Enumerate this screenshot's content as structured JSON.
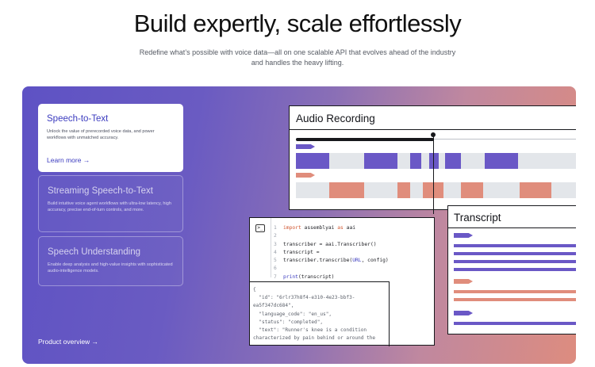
{
  "hero": {
    "title": "Build expertly, scale effortlessly",
    "subtitle": "Redefine what’s possible with voice data—all on one scalable API that evolves ahead of the industry and handles the heavy lifting."
  },
  "cards": [
    {
      "title": "Speech-to-Text",
      "desc": "Unlock the value of prerecorded voice data, and power workflows with unmatched accuracy.",
      "link": "Learn more →"
    },
    {
      "title": "Streaming Speech-to-Text",
      "desc": "Build intuitive voice agent workflows with ultra-low latency, high accuracy, precise end-of-turn controls, and more."
    },
    {
      "title": "Speech Understanding",
      "desc": "Enable deep analysis and high-value insights with sophisticated audio-intelligence models."
    }
  ],
  "product_overview": "Product overview →",
  "audio": {
    "title": "Audio Recording"
  },
  "transcript": {
    "title": "Transcript"
  },
  "code": {
    "terminal_icon": ">_",
    "line_numbers": [
      "1",
      "2",
      "3",
      "4",
      "5",
      "6",
      "7"
    ],
    "import_kw": "import",
    "import_mod": "assemblyai",
    "as_kw": "as",
    "import_alias": "aai",
    "line3": "transcriber = aai.Transcriber()",
    "line4": "transcript =",
    "line5_a": "transcriber.transcribe(",
    "line5_b": "URL",
    "line5_c": ", config)",
    "line7_fn": "print",
    "line7_rest": "(transcript)"
  },
  "output": [
    "{",
    "  \"id\": \"6rlr37h8f4-e310-4e23-bbf3-",
    "ea5f347dc684\",",
    "  \"language_code\": \"en_us\",",
    "  \"status\": \"completed\",",
    "  \"text\": \"Runner's knee is a condition",
    "characterized by pain behind or around the"
  ],
  "colors": {
    "accent": "#3b3bbf",
    "speaker_a": "#6a58c6",
    "speaker_b": "#e08d7c",
    "track_bg": "#e3e6ea"
  },
  "icons": [
    "terminal-icon",
    "arrow-right-icon"
  ]
}
